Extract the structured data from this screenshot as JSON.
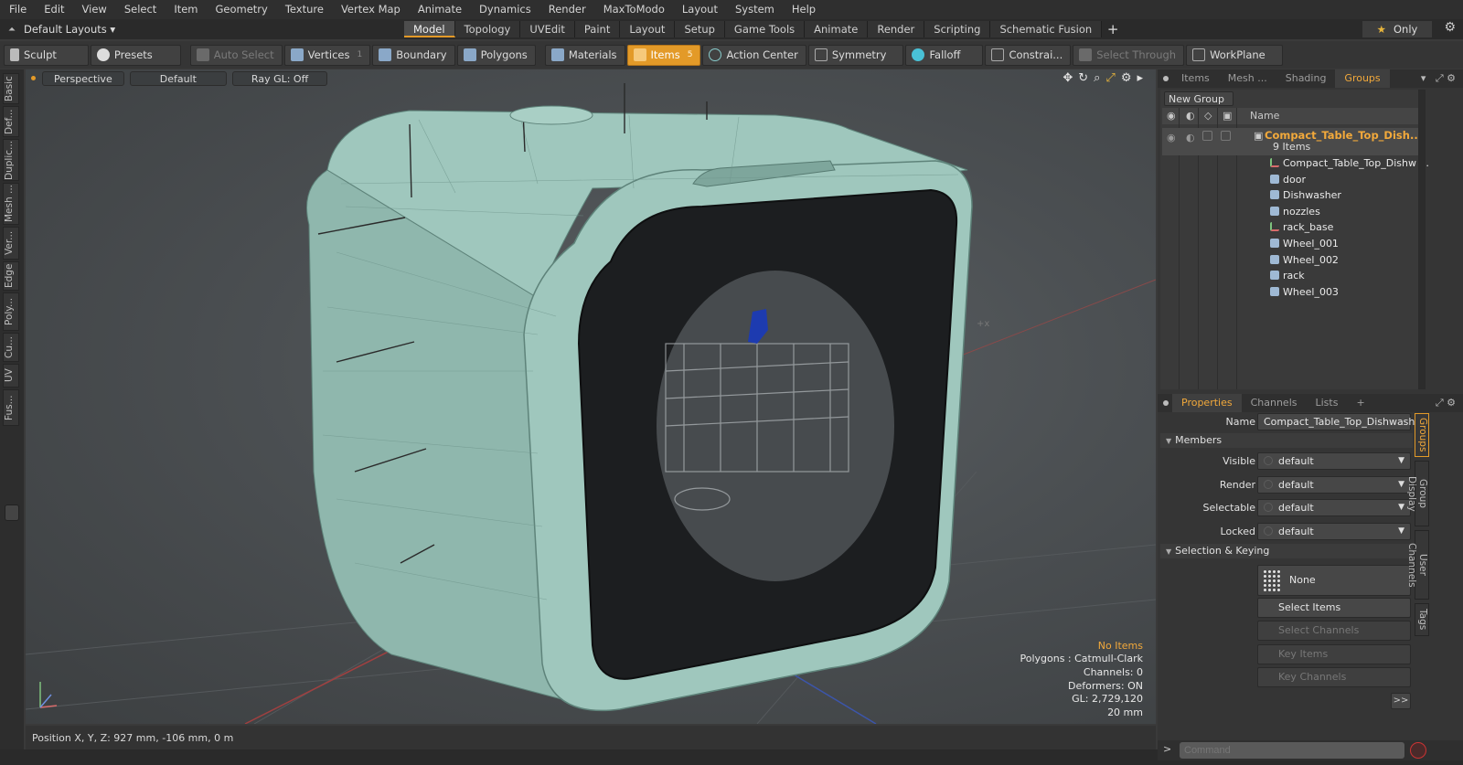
{
  "menubar": [
    "File",
    "Edit",
    "View",
    "Select",
    "Item",
    "Geometry",
    "Texture",
    "Vertex Map",
    "Animate",
    "Dynamics",
    "Render",
    "MaxToModo",
    "Layout",
    "System",
    "Help"
  ],
  "layoutbar": {
    "layout_select": "Default Layouts ▾",
    "tabs": [
      {
        "label": "Model",
        "active": true
      },
      {
        "label": "Topology"
      },
      {
        "label": "UVEdit"
      },
      {
        "label": "Paint"
      },
      {
        "label": "Layout"
      },
      {
        "label": "Setup"
      },
      {
        "label": "Game Tools"
      },
      {
        "label": "Animate"
      },
      {
        "label": "Render"
      },
      {
        "label": "Scripting"
      },
      {
        "label": "Schematic Fusion"
      }
    ],
    "plus": "+",
    "only_label": "Only",
    "only_icon": "star-icon",
    "gear_icon": "gear-icon"
  },
  "toolbar": {
    "sculpt": "Sculpt",
    "presets": "Presets",
    "auto_select": "Auto Select",
    "vertices": "Vertices",
    "vertices_count": "1",
    "boundary": "Boundary",
    "polygons": "Polygons",
    "materials": "Materials",
    "items": "Items",
    "items_count": "5",
    "action_center": "Action Center",
    "symmetry": "Symmetry",
    "falloff": "Falloff",
    "constraints": "Constrai...",
    "select_through": "Select Through",
    "workplane": "WorkPlane"
  },
  "left_tabs": [
    "Basic",
    "Def...",
    "Duplic...",
    "Mesh ...",
    "Ver...",
    "Edge",
    "Poly...",
    "Cu...",
    "UV",
    "Fus..."
  ],
  "viewport": {
    "perspective": "Perspective",
    "default": "Default",
    "raygl": "Ray GL: Off",
    "info": {
      "no_items": "No Items",
      "polygons": "Polygons : Catmull-Clark",
      "channels": "Channels: 0",
      "deformers": "Deformers: ON",
      "gl": "GL: 2,729,120",
      "scale": "20 mm"
    },
    "accent": "#f2a93b"
  },
  "statusbar": {
    "position": "Position X, Y, Z:  927 mm, -106 mm, 0 m"
  },
  "right_panel": {
    "top_tabs": [
      {
        "label": "Items"
      },
      {
        "label": "Mesh ..."
      },
      {
        "label": "Shading"
      },
      {
        "label": "Groups",
        "active": true
      }
    ],
    "new_group": "New Group",
    "header_name": "Name",
    "root_name": "Compact_Table_Top_Dish...",
    "root_sub": "9 Items",
    "children": [
      {
        "label": "Compact_Table_Top_Dishw ...",
        "icon": "locator-icon"
      },
      {
        "label": "door",
        "icon": "mesh-icon"
      },
      {
        "label": "Dishwasher",
        "icon": "mesh-icon"
      },
      {
        "label": "nozzles",
        "icon": "mesh-icon"
      },
      {
        "label": "rack_base",
        "icon": "locator-icon"
      },
      {
        "label": "Wheel_001",
        "icon": "mesh-icon"
      },
      {
        "label": "Wheel_002",
        "icon": "mesh-icon"
      },
      {
        "label": "rack",
        "icon": "mesh-icon"
      },
      {
        "label": "Wheel_003",
        "icon": "mesh-icon"
      }
    ],
    "prop_tabs": [
      {
        "label": "Properties",
        "active": true
      },
      {
        "label": "Channels"
      },
      {
        "label": "Lists"
      },
      {
        "label": "+"
      }
    ],
    "properties": {
      "name_label": "Name",
      "name_value": "Compact_Table_Top_Dishwasher",
      "members": "Members",
      "visible_label": "Visible",
      "visible_value": "default",
      "render_label": "Render",
      "render_value": "default",
      "selectable_label": "Selectable",
      "selectable_value": "default",
      "locked_label": "Locked",
      "locked_value": "default",
      "selection_keying": "Selection & Keying",
      "none": "None",
      "select_items": "Select Items",
      "select_channels": "Select Channels",
      "key_items": "Key Items",
      "key_channels": "Key Channels",
      "more": ">>"
    },
    "side_tabs": [
      {
        "label": "Groups",
        "active": true
      },
      {
        "label": "Group Display"
      },
      {
        "label": "User Channels"
      },
      {
        "label": "Tags"
      }
    ],
    "command_placeholder": "Command",
    "command_prompt": ">"
  }
}
